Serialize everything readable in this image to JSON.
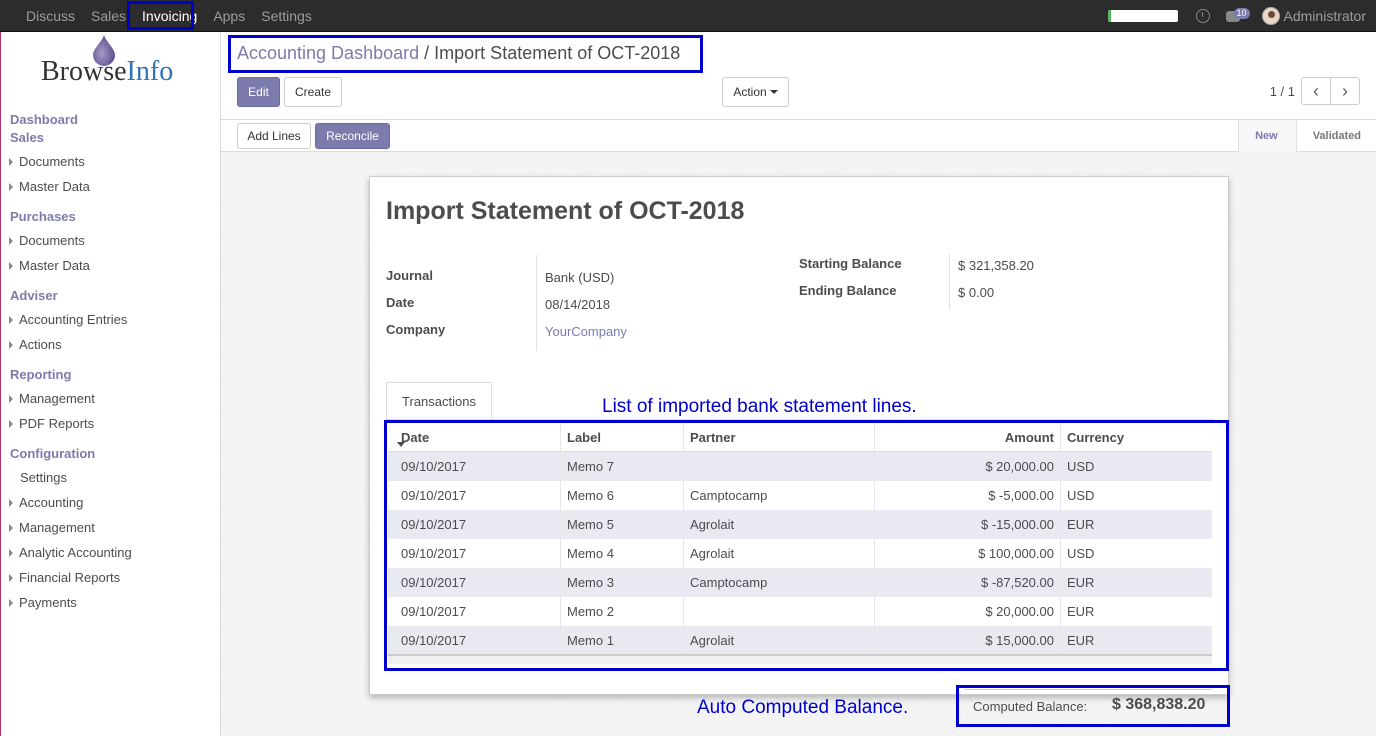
{
  "topbar": {
    "menu": [
      "Discuss",
      "Sales",
      "Invoicing",
      "Apps",
      "Settings"
    ],
    "active_menu": "Invoicing",
    "setup_progress": 0.05,
    "chat_badge": "10",
    "user_name": "Administrator"
  },
  "logo": {
    "part1": "Browse",
    "part2": "Info"
  },
  "sidebar": {
    "sections": [
      {
        "title": "Dashboard",
        "items": []
      },
      {
        "title": "Sales",
        "items": [
          "Documents",
          "Master Data"
        ]
      },
      {
        "title": "Purchases",
        "items": [
          "Documents",
          "Master Data"
        ]
      },
      {
        "title": "Adviser",
        "items": [
          "Accounting Entries",
          "Actions"
        ]
      },
      {
        "title": "Reporting",
        "items": [
          "Management",
          "PDF Reports"
        ]
      },
      {
        "title": "Configuration",
        "items": [
          "Settings",
          "Accounting",
          "Management",
          "Analytic Accounting",
          "Financial Reports",
          "Payments"
        ]
      }
    ]
  },
  "breadcrumb": {
    "parent": "Accounting Dashboard",
    "separator": "/",
    "current": "Import Statement of OCT-2018"
  },
  "buttons": {
    "edit": "Edit",
    "create": "Create",
    "action": "Action",
    "add_lines": "Add Lines",
    "reconcile": "Reconcile"
  },
  "pager": {
    "text": "1 / 1",
    "prev": "‹",
    "next": "›"
  },
  "status": {
    "steps": [
      "New",
      "Validated"
    ],
    "current": "New"
  },
  "record": {
    "title": "Import Statement of OCT-2018",
    "fields_left": [
      {
        "label": "Journal",
        "value": "Bank (USD)"
      },
      {
        "label": "Date",
        "value": "08/14/2018"
      },
      {
        "label": "Company",
        "value": "YourCompany"
      }
    ],
    "fields_right": [
      {
        "label": "Starting Balance",
        "value": "$ 321,358.20"
      },
      {
        "label": "Ending Balance",
        "value": "$ 0.00"
      }
    ]
  },
  "tab": {
    "label": "Transactions"
  },
  "annotations": {
    "table_note": "List of imported bank statement lines.",
    "balance_note": "Auto Computed Balance."
  },
  "table": {
    "columns": [
      "Date",
      "Label",
      "Partner",
      "Amount",
      "Currency"
    ],
    "rows": [
      [
        "09/10/2017",
        "Memo 7",
        "",
        "$ 20,000.00",
        "USD"
      ],
      [
        "09/10/2017",
        "Memo 6",
        "Camptocamp",
        "$ -5,000.00",
        "USD"
      ],
      [
        "09/10/2017",
        "Memo 5",
        "Agrolait",
        "$ -15,000.00",
        "EUR"
      ],
      [
        "09/10/2017",
        "Memo 4",
        "Agrolait",
        "$ 100,000.00",
        "USD"
      ],
      [
        "09/10/2017",
        "Memo 3",
        "Camptocamp",
        "$ -87,520.00",
        "EUR"
      ],
      [
        "09/10/2017",
        "Memo 2",
        "",
        "$ 20,000.00",
        "EUR"
      ],
      [
        "09/10/2017",
        "Memo 1",
        "Agrolait",
        "$ 15,000.00",
        "EUR"
      ]
    ]
  },
  "computed_balance": {
    "label": "Computed Balance:",
    "value": "$ 368,838.20"
  },
  "colors": {
    "accent": "#7c7bad",
    "annotation": "#0000cc",
    "topbar": "#2c2c2c"
  }
}
